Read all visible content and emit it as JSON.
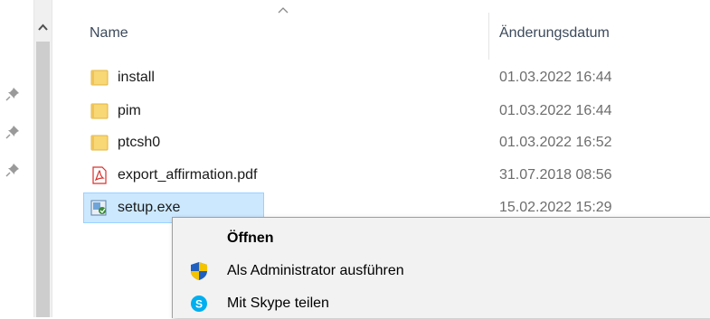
{
  "header": {
    "col_name": "Name",
    "col_date": "Änderungsdatum"
  },
  "files": [
    {
      "name": "install",
      "date": "01.03.2022 16:44",
      "icon": "folder-icon"
    },
    {
      "name": "pim",
      "date": "01.03.2022 16:44",
      "icon": "folder-icon"
    },
    {
      "name": "ptcsh0",
      "date": "01.03.2022 16:52",
      "icon": "folder-icon"
    },
    {
      "name": "export_affirmation.pdf",
      "date": "31.07.2018 08:56",
      "icon": "pdf-icon"
    },
    {
      "name": "setup.exe",
      "date": "15.02.2022 15:29",
      "icon": "installer-icon",
      "selected": true
    }
  ],
  "context_menu": {
    "items": [
      {
        "label": "Öffnen",
        "bold": true
      },
      {
        "label": "Als Administrator ausführen",
        "icon": "uac-shield-icon"
      },
      {
        "label": "Mit Skype teilen",
        "icon": "skype-icon"
      }
    ]
  },
  "colors": {
    "selection_bg": "#cce8ff",
    "selection_border": "#99d1ff",
    "menu_bg": "#f2f2f2",
    "folder": "#f8d775",
    "pdf_red": "#d9302c",
    "skype_blue": "#00aff0",
    "shield_blue": "#1f5fbf",
    "shield_yellow": "#f5c400"
  }
}
